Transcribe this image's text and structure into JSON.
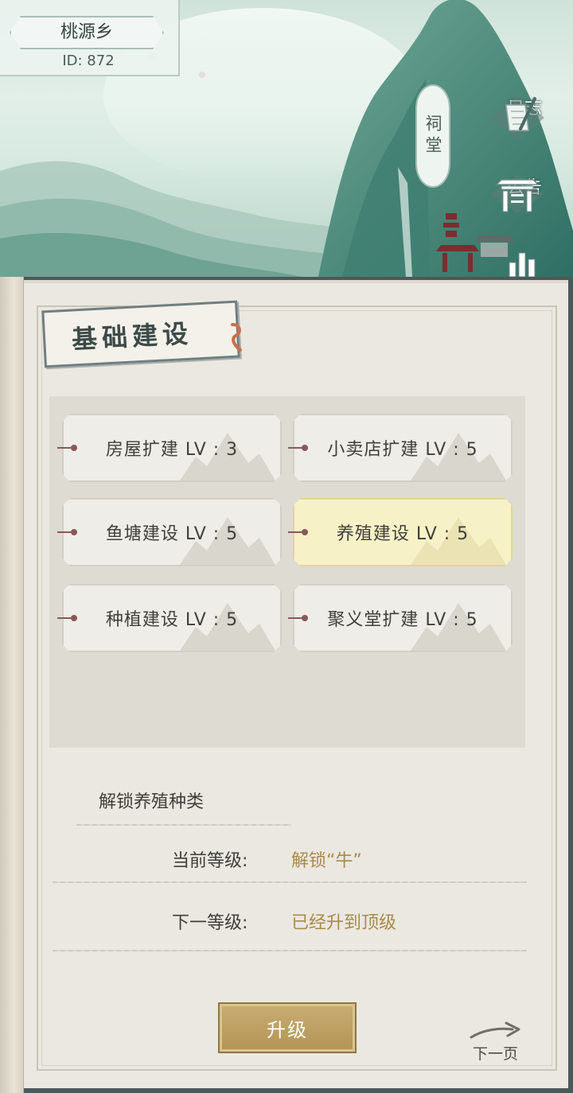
{
  "village": {
    "name": "桃源乡",
    "id_text": "ID: 872"
  },
  "side_menu": {
    "ancestral_hall": "祠堂",
    "log": "日志",
    "announcement": "公告"
  },
  "section": {
    "title": "基础建设"
  },
  "buildings": [
    {
      "label": "房屋扩建 LV : 3",
      "selected": false
    },
    {
      "label": "小卖店扩建 LV : 5",
      "selected": false
    },
    {
      "label": "鱼塘建设 LV : 5",
      "selected": false
    },
    {
      "label": "养殖建设 LV : 5",
      "selected": true
    },
    {
      "label": "种植建设 LV : 5",
      "selected": false
    },
    {
      "label": "聚义堂扩建 LV : 5",
      "selected": false
    }
  ],
  "details": {
    "title": "解锁养殖种类",
    "current_level_label": "当前等级:",
    "current_level_value": "解锁“牛”",
    "next_level_label": "下一等级:",
    "next_level_value": "已经升到顶级"
  },
  "actions": {
    "upgrade": "升级",
    "next_page": "下一页"
  },
  "colors": {
    "accent_gold": "#a88b48",
    "button_gold": "#b39455",
    "selected_bg": "#f7f1c7",
    "pin_red": "#8a5858"
  }
}
